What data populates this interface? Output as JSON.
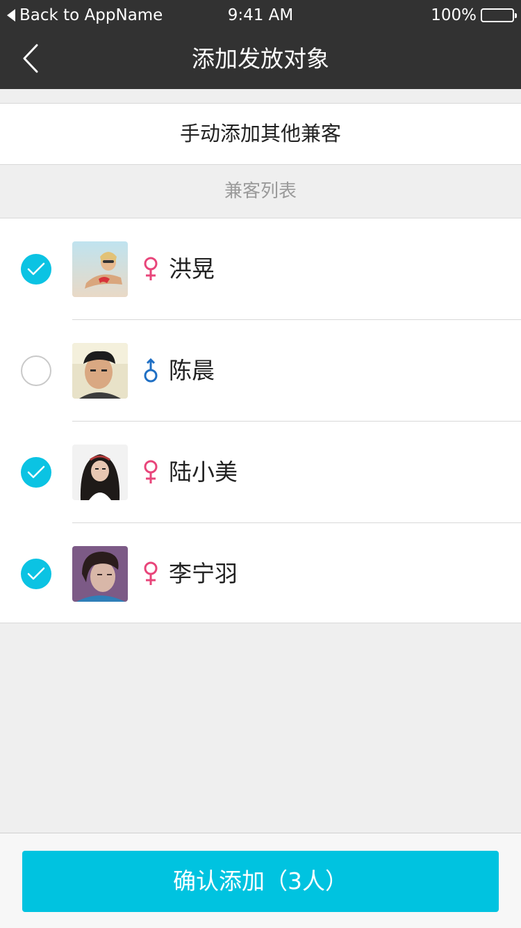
{
  "status_bar": {
    "back_label": "Back to AppName",
    "time": "9:41 AM",
    "battery": "100%"
  },
  "nav": {
    "title": "添加发放对象"
  },
  "manual_add_label": "手动添加其他兼客",
  "section_header": "兼客列表",
  "people": [
    {
      "name": "洪晃",
      "gender": "female",
      "checked": true
    },
    {
      "name": "陈晨",
      "gender": "male",
      "checked": false
    },
    {
      "name": "陆小美",
      "gender": "female",
      "checked": true
    },
    {
      "name": "李宁羽",
      "gender": "female",
      "checked": true
    }
  ],
  "confirm_button": "确认添加（3人）",
  "colors": {
    "accent": "#00c3e0",
    "female": "#e8457a",
    "male": "#1f6fc4",
    "nav_bg": "#323232"
  }
}
